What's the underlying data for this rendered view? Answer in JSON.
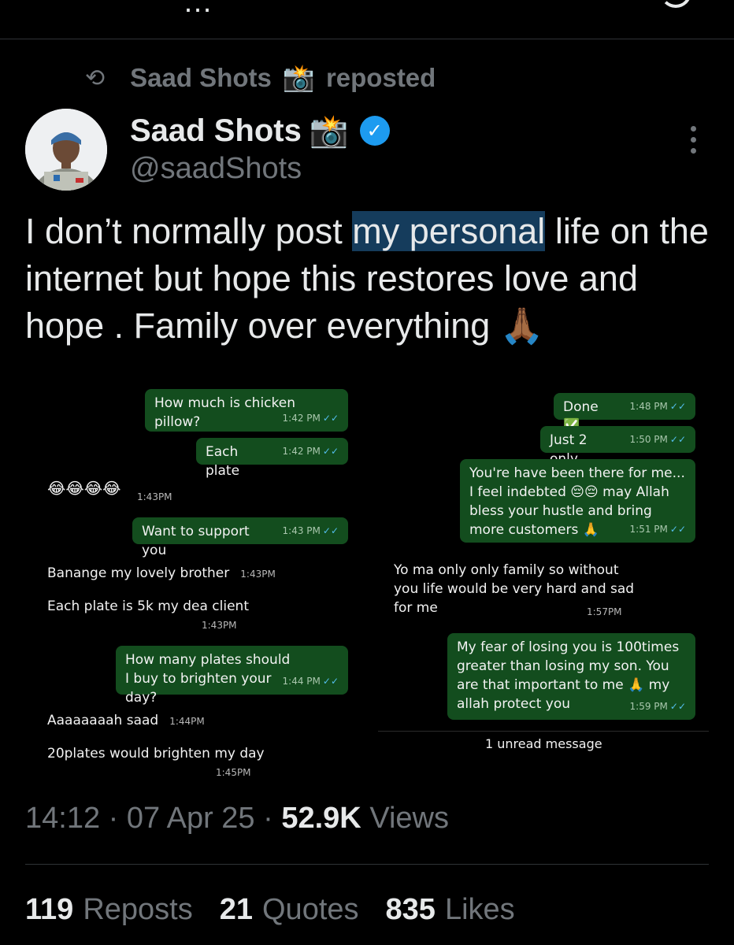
{
  "repost": {
    "name": "Saad Shots",
    "suffix": "reposted"
  },
  "author": {
    "name": "Saad Shots",
    "handle": "@saadShots"
  },
  "tweet": {
    "before": "I don’t normally post ",
    "highlight": "my personal",
    "after": " life on the internet but hope this restores love and hope . Family over everything 🙏🏾"
  },
  "chat_left": {
    "out": [
      {
        "text": "How much is chicken pillow?",
        "time": "1:42 PM"
      },
      {
        "text": "Each plate",
        "time": "1:42 PM"
      },
      {
        "text": "Want to support you",
        "time": "1:43 PM"
      },
      {
        "text": "How many plates should I buy to brighten your day?",
        "time": "1:44 PM"
      }
    ],
    "incoming": [
      {
        "text": "😂😂😂😂",
        "time": "1:43PM"
      },
      {
        "text": "Banange my lovely brother",
        "time": "1:43PM"
      },
      {
        "text": "Each plate is 5k my dea client",
        "time": "1:43PM"
      },
      {
        "text": "Aaaaaaaah saad",
        "time": "1:44PM"
      },
      {
        "text": "20plates would brighten my day",
        "time": "1:45PM"
      }
    ]
  },
  "chat_right": {
    "out": [
      {
        "text": "Done ✅",
        "time": "1:48 PM"
      },
      {
        "text": "Just 2 only",
        "time": "1:50 PM"
      },
      {
        "text": "You're have been there for me... I feel indebted 😔😔 may Allah bless your hustle and bring more customers 🙏",
        "time": "1:51 PM"
      },
      {
        "text": "My fear of losing you is 100times greater than losing my son. You are that important to me 🙏 my allah protect you",
        "time": "1:59 PM"
      }
    ],
    "incoming": [
      {
        "text": "Yo ma only only family so without you life would be very hard and sad for me",
        "time": "1:57PM"
      }
    ],
    "unread": "1 unread message"
  },
  "meta": {
    "time": "14:12",
    "date": "07 Apr 25",
    "views_count": "52.9K",
    "views_label": "Views"
  },
  "stats": {
    "reposts_count": "119",
    "reposts_label": "Reposts",
    "quotes_count": "21",
    "quotes_label": "Quotes",
    "likes_count": "835",
    "likes_label": "Likes"
  },
  "colors": {
    "background": "#000000",
    "muted": "#71767b",
    "verified": "#1d9bf0",
    "bubble": "#134d1e",
    "highlight": "#153c5c"
  },
  "icons": [
    "repost-icon",
    "camera-flash-icon",
    "verified-badge-icon",
    "more-icon",
    "double-check-icon"
  ]
}
